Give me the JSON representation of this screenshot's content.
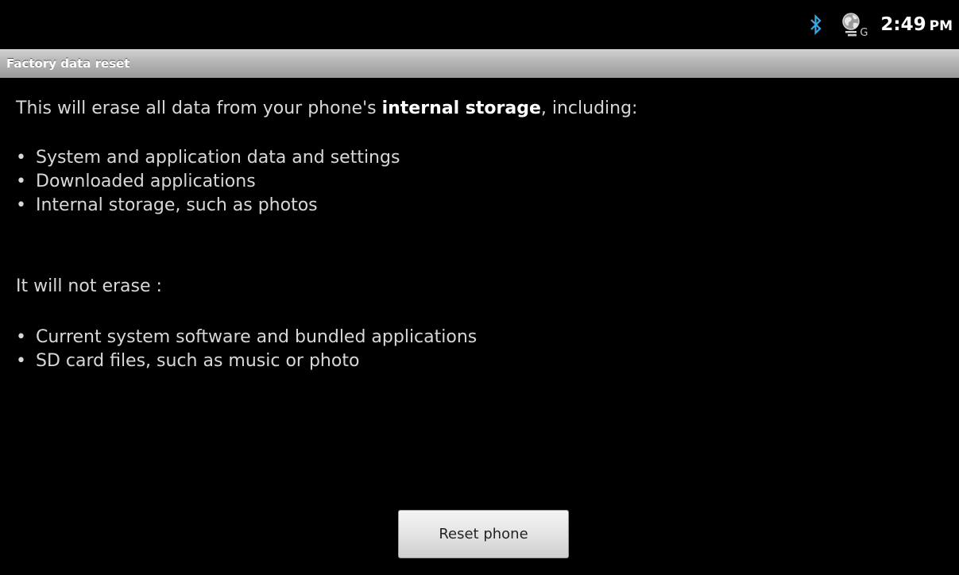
{
  "status_bar": {
    "time": "2:49",
    "ampm": "PM",
    "network_letter": "G",
    "icons": [
      "bluetooth-icon",
      "network-globe-icon"
    ],
    "bluetooth_color": "#3aa6e6"
  },
  "title_bar": {
    "title": "Factory data reset"
  },
  "content": {
    "intro_prefix": "This will erase all data from your phone's ",
    "intro_bold": "internal storage",
    "intro_suffix": ", including:",
    "erase_items": [
      "System and application data and settings",
      "Downloaded applications",
      "Internal storage, such as photos"
    ],
    "not_erase_heading": "It will not erase :",
    "keep_items": [
      "Current system software and bundled applications",
      "SD card files, such as music or photo"
    ],
    "bullet": "•"
  },
  "actions": {
    "reset_label": "Reset phone"
  }
}
